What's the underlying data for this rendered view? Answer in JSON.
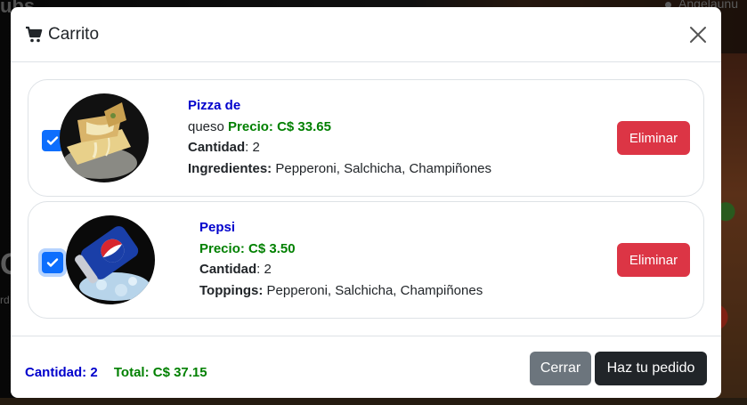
{
  "background": {
    "brand_fragment": "ubs",
    "user_fragment": "Angelaunu",
    "left_fragment_big": "C",
    "left_fragment_small": "rd"
  },
  "modal": {
    "title": "Carrito",
    "icons": {
      "title": "shopping-cart-icon",
      "close": "close-icon",
      "check": "check-icon"
    },
    "items": [
      {
        "name": "Pizza de",
        "name_cont": "queso",
        "price": "Precio: C$ 33.65",
        "qty_label": "Cantidad",
        "qty_value": ": 2",
        "extras_label": "Ingredientes:",
        "extras_value": " Pepperoni, Salchicha, Champiñones",
        "delete_label": "Eliminar",
        "checked": true
      },
      {
        "name": "Pepsi",
        "price": "Precio: C$ 3.50",
        "qty_label": "Cantidad",
        "qty_value": ": 2",
        "extras_label": "Toppings:",
        "extras_value": " Pepperoni, Salchicha, Champiñones",
        "delete_label": "Eliminar",
        "checked": true
      }
    ],
    "footer": {
      "qty_summary": "Cantidad: 2",
      "total_summary": "Total: C$ 37.15",
      "close_label": "Cerrar",
      "order_label": "Haz tu pedido"
    }
  },
  "colors": {
    "primary": "#0d6efd",
    "danger": "#dc3545",
    "secondary": "#6c757d",
    "dark": "#212529",
    "name_blue": "#0000cc",
    "price_green": "#008000"
  }
}
